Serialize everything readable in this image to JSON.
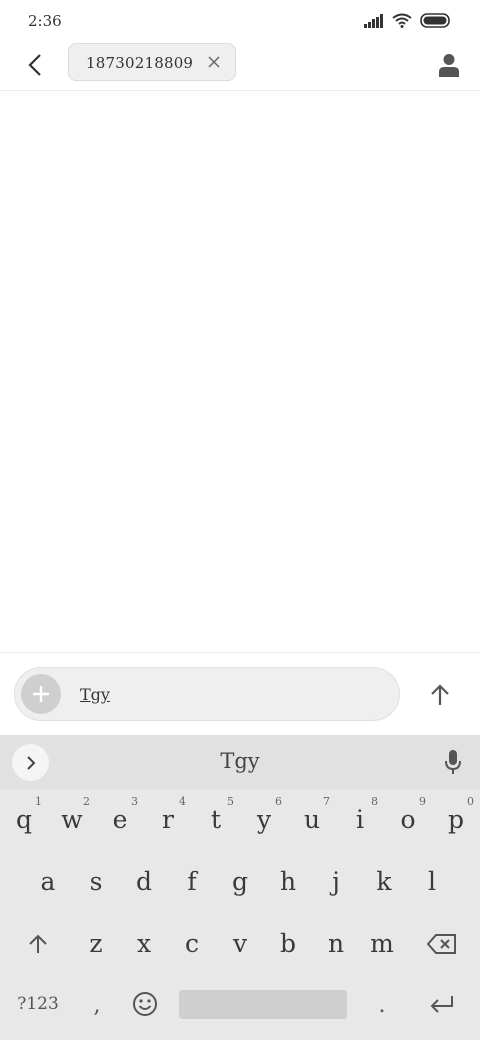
{
  "status_bar": {
    "time": "2:36"
  },
  "header": {
    "recipient_number": "18730218809"
  },
  "compose": {
    "text": "Tgy"
  },
  "keyboard": {
    "suggestion": "Tgy",
    "row1": [
      {
        "key": "q",
        "hint": "1"
      },
      {
        "key": "w",
        "hint": "2"
      },
      {
        "key": "e",
        "hint": "3"
      },
      {
        "key": "r",
        "hint": "4"
      },
      {
        "key": "t",
        "hint": "5"
      },
      {
        "key": "y",
        "hint": "6"
      },
      {
        "key": "u",
        "hint": "7"
      },
      {
        "key": "i",
        "hint": "8"
      },
      {
        "key": "o",
        "hint": "9"
      },
      {
        "key": "p",
        "hint": "0"
      }
    ],
    "row2": [
      "a",
      "s",
      "d",
      "f",
      "g",
      "h",
      "j",
      "k",
      "l"
    ],
    "row3": [
      "z",
      "x",
      "c",
      "v",
      "b",
      "n",
      "m"
    ],
    "symbols_label": "?123",
    "comma_label": ",",
    "period_label": "."
  },
  "icons": {
    "back": "chevron-left-icon",
    "chip_close": "close-icon",
    "contact": "person-icon",
    "attach": "plus-icon",
    "send": "arrow-up-icon",
    "expand": "chevron-right-icon",
    "mic": "mic-icon",
    "shift": "shift-icon",
    "backspace": "backspace-icon",
    "emoji": "emoji-icon",
    "enter": "enter-icon"
  }
}
